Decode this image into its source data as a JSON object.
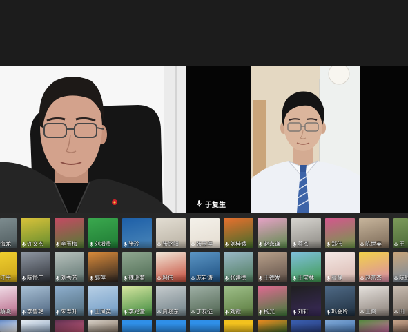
{
  "theme": {
    "page_background": "#1c1c1c",
    "stage_background": "#060606",
    "grid_background": "#272727",
    "label_color": "#ffffff"
  },
  "stage": {
    "right_tile": {
      "name": "于复生",
      "icon": "microphone-icon"
    }
  },
  "participants": {
    "icon": "microphone-icon",
    "rows": [
      [
        {
          "name": "海龙",
          "bg": [
            "#7d8c8f",
            "#4f5b5e"
          ]
        },
        {
          "name": "许文杰",
          "bg": [
            "#d9c23a",
            "#5f8a2e"
          ]
        },
        {
          "name": "李玉梅",
          "bg": [
            "#c44a63",
            "#4f7d33"
          ]
        },
        {
          "name": "刘增贵",
          "bg": [
            "#3aa84e",
            "#1f7a34"
          ]
        },
        {
          "name": "张玲",
          "bg": [
            "#1d5fa8",
            "#4a86b8"
          ]
        },
        {
          "name": "张铭阳",
          "bg": [
            "#e2ddd2",
            "#b9b1a3"
          ]
        },
        {
          "name": "张玉萍",
          "bg": [
            "#f4f1ea",
            "#e4dcd0"
          ]
        },
        {
          "name": "刘桂娥",
          "bg": [
            "#e8702e",
            "#3e6b2a"
          ]
        },
        {
          "name": "赵永谦",
          "bg": [
            "#e6a2c6",
            "#5a8a4a"
          ]
        },
        {
          "name": "蔡杰",
          "bg": [
            "#d6d4cf",
            "#8d8a84"
          ]
        },
        {
          "name": "郑伟",
          "bg": [
            "#d4578d",
            "#6f9a4a"
          ]
        },
        {
          "name": "陈世英",
          "bg": [
            "#c7b59c",
            "#7a6856"
          ]
        },
        {
          "name": "王",
          "bg": [
            "#7c9a5a",
            "#4d6a38"
          ]
        }
      ],
      [
        {
          "name": "江平",
          "bg": [
            "#f0cf2e",
            "#c9a21a"
          ]
        },
        {
          "name": "陈怀广",
          "bg": [
            "#8f97a3",
            "#2f3238"
          ]
        },
        {
          "name": "刘秀芳",
          "bg": [
            "#b8c2bd",
            "#5f7470"
          ]
        },
        {
          "name": "郭萍",
          "bg": [
            "#d98a3a",
            "#2b2420"
          ]
        },
        {
          "name": "魏瑞菊",
          "bg": [
            "#8fa790",
            "#4d6a52"
          ]
        },
        {
          "name": "冯伟",
          "bg": [
            "#f2e6d6",
            "#c44b3a"
          ]
        },
        {
          "name": "庞岩涛",
          "bg": [
            "#5b95c4",
            "#1d4f80"
          ]
        },
        {
          "name": "张建德",
          "bg": [
            "#9ab8c8",
            "#4d7a5a"
          ]
        },
        {
          "name": "王德发",
          "bg": [
            "#b8a08a",
            "#5f5048"
          ]
        },
        {
          "name": "王宝林",
          "bg": [
            "#7fbfdc",
            "#3f9a4e"
          ]
        },
        {
          "name": "高静",
          "bg": [
            "#f4e8e4",
            "#d9b8b0"
          ]
        },
        {
          "name": "赵燕杰",
          "bg": [
            "#f2d24a",
            "#d88aa8"
          ]
        },
        {
          "name": "陈敏",
          "bg": [
            "#c9a57a",
            "#7a8a9a"
          ]
        }
      ],
      [
        {
          "name": "蔡晓",
          "bg": [
            "#f0dce6",
            "#b86a8a"
          ]
        },
        {
          "name": "李鲁艳",
          "bg": [
            "#a9c1d6",
            "#4f6680"
          ]
        },
        {
          "name": "朱寿升",
          "bg": [
            "#8fb0cf",
            "#4f6a7a"
          ]
        },
        {
          "name": "王凤英",
          "bg": [
            "#b8d0e6",
            "#6f9ac4"
          ]
        },
        {
          "name": "李兆堂",
          "bg": [
            "#d6e6a0",
            "#3f8a3f"
          ]
        },
        {
          "name": "贾晓东",
          "bg": [
            "#c6ccce",
            "#6f7f86"
          ]
        },
        {
          "name": "丁友征",
          "bg": [
            "#9fb0a6",
            "#4f6450"
          ]
        },
        {
          "name": "刘霞",
          "bg": [
            "#9fc08a",
            "#5a7a3e"
          ]
        },
        {
          "name": "杨光",
          "bg": [
            "#e06a92",
            "#3f7a3a"
          ]
        },
        {
          "name": "刘轩",
          "bg": [
            "#1f1f1f",
            "#3a2a5a"
          ]
        },
        {
          "name": "巩会玲",
          "bg": [
            "#4f6a86",
            "#1f2f3f"
          ]
        },
        {
          "name": "王爽",
          "bg": [
            "#e6e2de",
            "#8a8078"
          ]
        },
        {
          "name": "田",
          "bg": [
            "#c9bdb2",
            "#7f7368"
          ]
        }
      ],
      [
        {
          "bg": [
            "#5f86c4",
            "#f0f0f0"
          ]
        },
        {
          "bg": [
            "#e8eef4",
            "#8fa6c0"
          ]
        },
        {
          "bg": [
            "#5a2f4f",
            "#c85a7a"
          ]
        },
        {
          "bg": [
            "#d6cfc6",
            "#8a7a6a"
          ]
        },
        {
          "bg": [
            "#2f8fe8",
            "#2f8fe8"
          ]
        },
        {
          "bg": [
            "#2f8fe8",
            "#2f8fe8"
          ]
        },
        {
          "bg": [
            "#2f8fe8",
            "#2f8fe8"
          ]
        },
        {
          "bg": [
            "#f2c21e",
            "#f2c21e"
          ]
        },
        {
          "bg": [
            "#f08a1e",
            "#3f6a2a"
          ]
        },
        {
          "bg": [
            "#3a5fb0",
            "#2a3f80"
          ]
        },
        {
          "bg": [
            "#7fa8d6",
            "#4a78b0"
          ]
        },
        {
          "bg": [
            "#4f8a3a",
            "#c86aa0"
          ]
        },
        {
          "bg": [
            "#c6a48a",
            "#8a6a5a"
          ]
        }
      ]
    ]
  }
}
